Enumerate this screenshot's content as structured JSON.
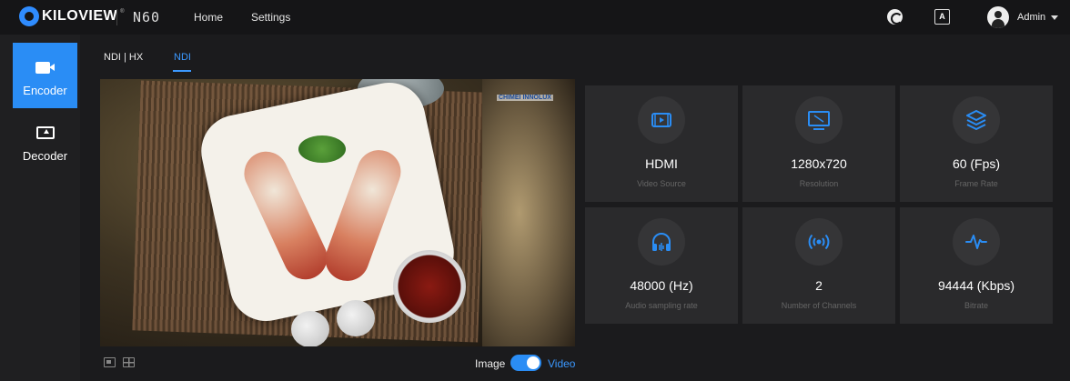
{
  "header": {
    "brand": "KILOVIEW",
    "brand_mark": "®",
    "model": "N60",
    "nav": [
      "Home",
      "Settings"
    ],
    "user": "Admin",
    "lang_icon": "A",
    "icons": [
      "refresh-icon",
      "language-icon",
      "user-avatar-icon",
      "chevron-down-icon"
    ]
  },
  "sidebar": {
    "items": [
      {
        "label": "Encoder",
        "icon": "camera-icon",
        "active": true
      },
      {
        "label": "Decoder",
        "icon": "monitor-upload-icon",
        "active": false
      }
    ]
  },
  "tabs": [
    {
      "label": "NDI | HX",
      "active": false
    },
    {
      "label": "NDI",
      "active": true
    }
  ],
  "preview": {
    "watermark": "CHIMEI INNOLUX",
    "mode_left": "Image",
    "mode_right": "Video",
    "video_mode_on": true
  },
  "stats": [
    {
      "value": "HDMI",
      "label": "Video Source",
      "icon": "video-source-icon"
    },
    {
      "value": "1280x720",
      "label": "Resolution",
      "icon": "resolution-icon"
    },
    {
      "value": "60 (Fps)",
      "label": "Frame Rate",
      "icon": "layers-icon"
    },
    {
      "value": "48000 (Hz)",
      "label": "Audio sampling rate",
      "icon": "headphones-icon"
    },
    {
      "value": "2",
      "label": "Number of Channels",
      "icon": "broadcast-icon"
    },
    {
      "value": "94444 (Kbps)",
      "label": "Bitrate",
      "icon": "waveform-icon"
    }
  ],
  "colors": {
    "accent": "#2a8df5",
    "background": "#1b1b1d",
    "card": "#2a2a2c"
  }
}
